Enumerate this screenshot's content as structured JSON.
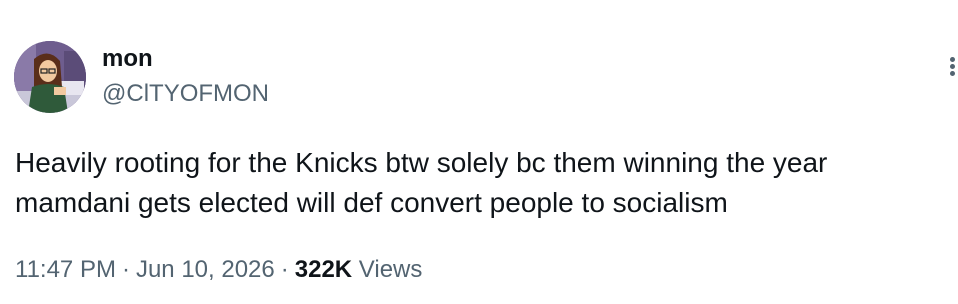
{
  "author": {
    "display_name": "mon",
    "handle": "@ClTYOFMON",
    "avatar_icon": "cartoon-girl-avatar"
  },
  "tweet": {
    "text": "Heavily rooting for the Knicks btw solely bc them winning the year\nmamdani gets elected will def convert people to socialism",
    "time": "11:47 PM",
    "date": "Jun 10, 2026",
    "separator": "·",
    "views_count": "322K",
    "views_label": "Views"
  },
  "icons": {
    "more": "more-options-icon"
  },
  "colors": {
    "primary_text": "#0f1419",
    "secondary_text": "#536471",
    "background": "#ffffff"
  }
}
